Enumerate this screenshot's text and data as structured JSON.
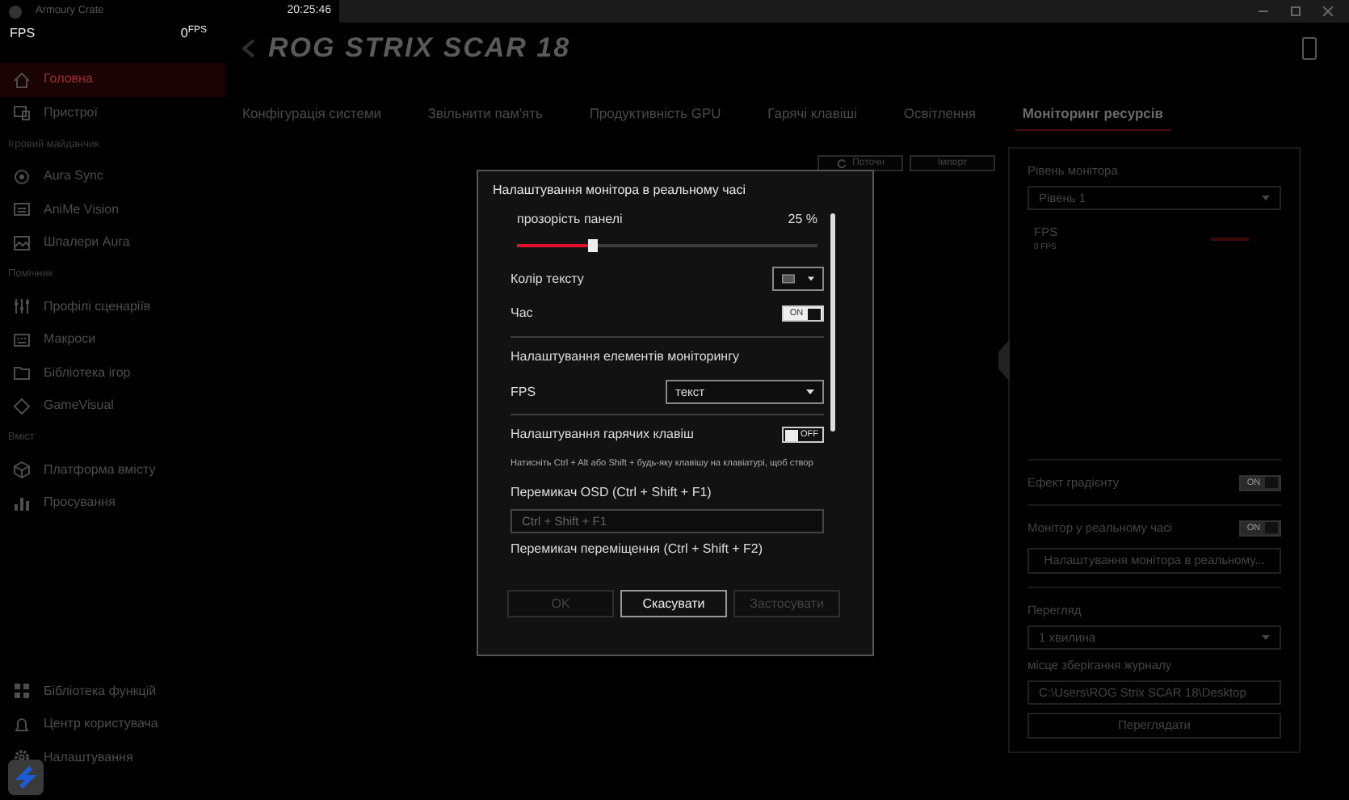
{
  "window": {
    "title": "Armoury Crate"
  },
  "osd": {
    "time": "20:25:46",
    "label": "FPS",
    "value": "0",
    "unit": "FPS"
  },
  "header": {
    "logo": "ROG STRIX SCAR 18"
  },
  "sidebar": {
    "items": [
      {
        "kind": "item",
        "label": "Головна",
        "selected": true
      },
      {
        "kind": "item",
        "label": "Пристрої",
        "selected": false
      },
      {
        "kind": "section",
        "label": "Ігровий майданчик"
      },
      {
        "kind": "item",
        "label": "Aura Sync",
        "selected": false
      },
      {
        "kind": "item",
        "label": "AniMe Vision",
        "selected": false
      },
      {
        "kind": "item",
        "label": "Шпалери Aura",
        "selected": false
      },
      {
        "kind": "section",
        "label": "Помічник"
      },
      {
        "kind": "item",
        "label": "Профілі сценаріїв",
        "selected": false
      },
      {
        "kind": "item",
        "label": "Макроси",
        "selected": false
      },
      {
        "kind": "item",
        "label": "Бібліотека ігор",
        "selected": false
      },
      {
        "kind": "item",
        "label": "GameVisual",
        "selected": false
      },
      {
        "kind": "section",
        "label": "Вміст"
      },
      {
        "kind": "item",
        "label": "Платформа вмісту",
        "selected": false
      },
      {
        "kind": "item",
        "label": "Просування",
        "selected": false
      }
    ],
    "bottom_items": [
      {
        "label": "Бібліотека функцій",
        "selected": false
      },
      {
        "label": "Центр користувача",
        "selected": false
      },
      {
        "label": "Налаштування",
        "selected": false
      }
    ]
  },
  "tabs": [
    {
      "label": "Конфігурація системи",
      "selected": false
    },
    {
      "label": "Звільнити пам'ять",
      "selected": false
    },
    {
      "label": "Продуктивність GPU",
      "selected": false
    },
    {
      "label": "Гарячі клавіші",
      "selected": false
    },
    {
      "label": "Освітлення",
      "selected": false
    },
    {
      "label": "Моніторинг ресурсів",
      "selected": true
    }
  ],
  "toolbar": {
    "buttons": [
      "Поточн",
      "Імпорт"
    ]
  },
  "monitor_panel": {
    "level_label": "Рівень монітора",
    "level_value": "Рівень 1",
    "entries": [
      {
        "name": "FPS",
        "reading": "0 FPS"
      }
    ],
    "toggles": [
      {
        "label": "Ефект градієнту",
        "toggle_text": "ON",
        "on": true
      },
      {
        "label": "Монітор у реальному часі",
        "toggle_text": "ON",
        "on": true
      }
    ],
    "settings_button": "Налаштування монітора в реальному...",
    "view_label": "Перегляд",
    "view_value": "1 хвилина",
    "log_label": "місце зберігання журналу",
    "log_path": "C:\\Users\\ROG Strix SCAR 18\\Desktop",
    "browse_button": "Переглядати"
  },
  "dialog": {
    "title": "Налаштування монітора в реальному часі",
    "sections": [
      {
        "rows": [
          {
            "kind": "slider",
            "label": "прозорість панелі",
            "reading": "25 %",
            "level": 0.25
          },
          {
            "kind": "color",
            "label": "Колір тексту"
          },
          {
            "kind": "toggle",
            "label": "Час",
            "toggle_text": "ON",
            "on": true
          }
        ]
      },
      {
        "rows": [
          {
            "kind": "heading",
            "label": "Налаштування елементів моніторингу"
          },
          {
            "kind": "select",
            "label": "FPS",
            "value": "текст"
          }
        ]
      },
      {
        "rows": [
          {
            "kind": "toggle",
            "label": "Налаштування гарячих клавіш",
            "toggle_text": "OFF",
            "on": false
          },
          {
            "kind": "hint",
            "label": "Натисніть Ctrl + Alt або Shift + будь-яку клавішу на клавіатурі, щоб створ"
          },
          {
            "kind": "field",
            "label": "Перемикач OSD (Ctrl + Shift + F1)",
            "placeholder": "Ctrl + Shift + F1"
          },
          {
            "kind": "heading",
            "label": "Перемикач переміщення (Ctrl + Shift + F2)"
          }
        ]
      }
    ],
    "buttons": [
      {
        "label": "OK",
        "disabled": true
      },
      {
        "label": "Скасувати",
        "disabled": false
      },
      {
        "label": "Застосувати",
        "disabled": true
      }
    ]
  }
}
